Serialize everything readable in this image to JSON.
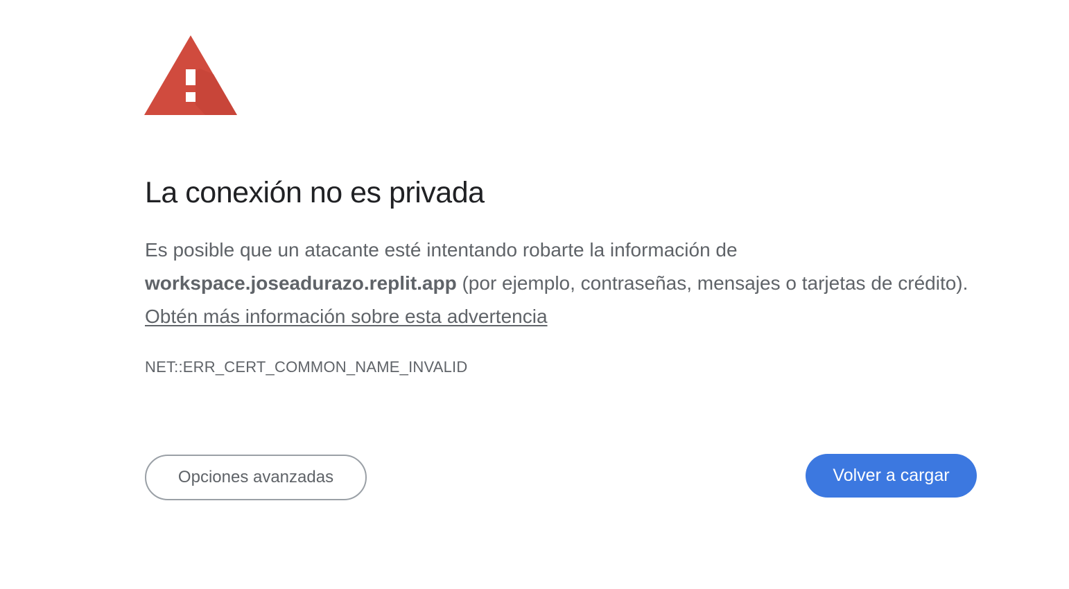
{
  "icon": {
    "name": "warning-triangle-icon",
    "color": "#d04b3e",
    "shadow_color": "#b53d31",
    "glyph_color": "#ffffff"
  },
  "title": "La conexión no es privada",
  "message": {
    "part1": "Es posible que un atacante esté intentando robarte la información de ",
    "hostname": "workspace.joseadurazo.replit.app",
    "part2": " (por ejemplo, contraseñas, mensajes o tarjetas de crédito). ",
    "learn_more_link": "Obtén más información sobre esta advertencia"
  },
  "error_code": "NET::ERR_CERT_COMMON_NAME_INVALID",
  "buttons": {
    "advanced_label": "Opciones avanzadas",
    "reload_label": "Volver a cargar"
  },
  "colors": {
    "title_text": "#202124",
    "body_text": "#5f6368",
    "primary_button": "#3c78e0",
    "secondary_button_border": "#9aa0a6"
  }
}
